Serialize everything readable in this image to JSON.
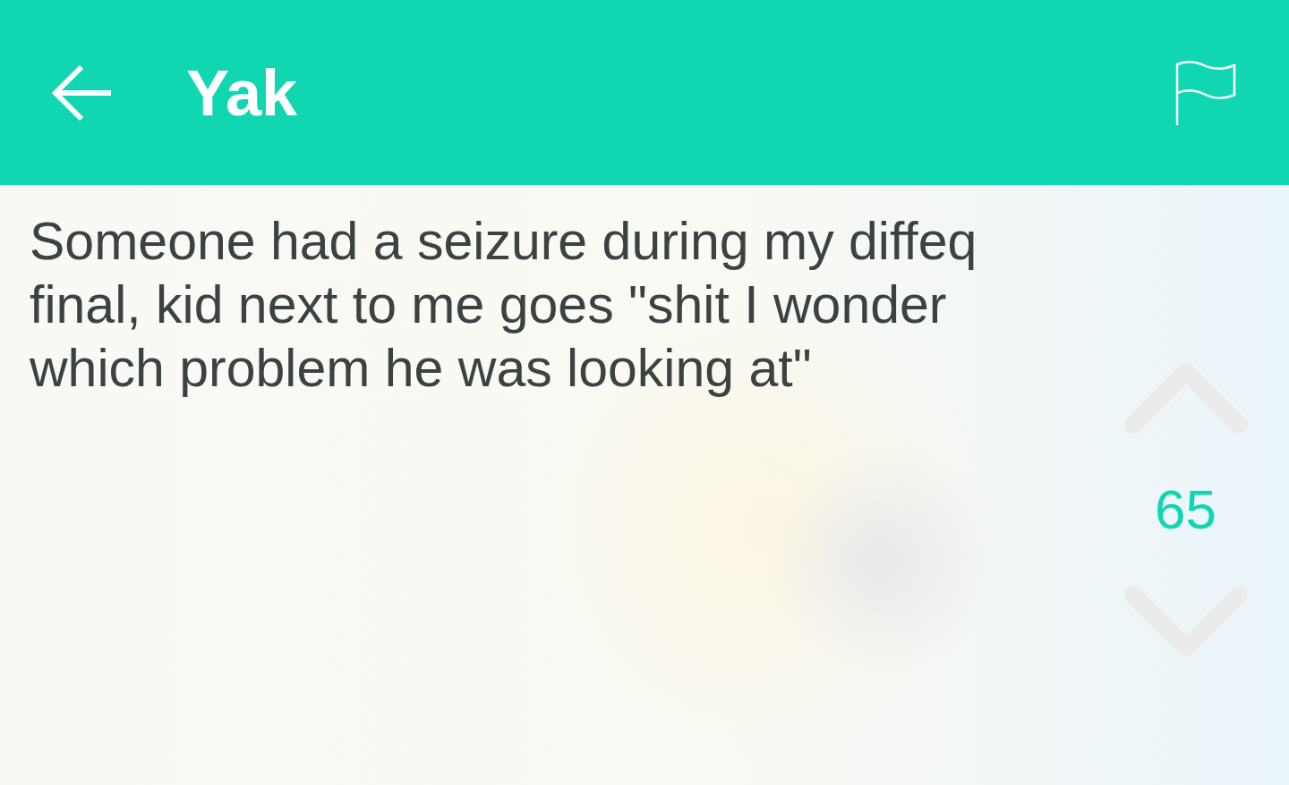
{
  "header": {
    "title": "Yak"
  },
  "post": {
    "text": "Someone had a seizure during my diffeq final, kid next to me goes \"shit I wonder which problem he was looking at\""
  },
  "votes": {
    "count": "65"
  }
}
